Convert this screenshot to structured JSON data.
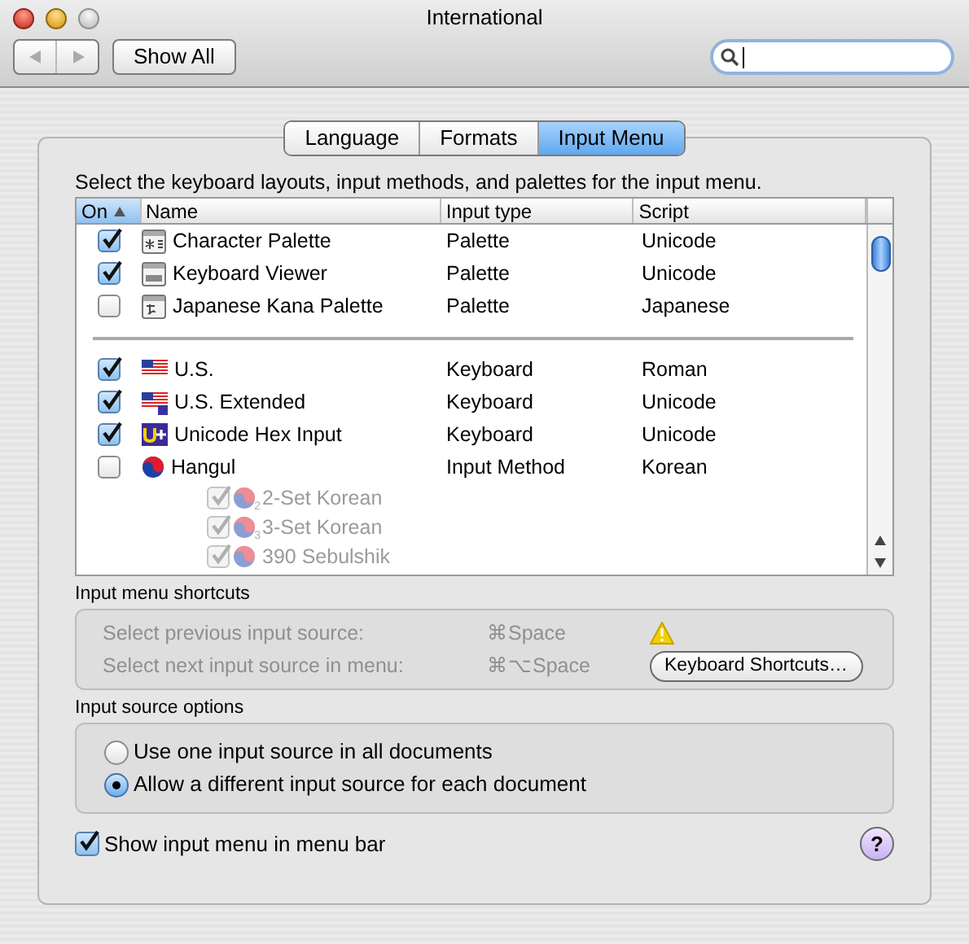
{
  "window": {
    "title": "International"
  },
  "toolbar": {
    "show_all": "Show All"
  },
  "tabs": [
    {
      "label": "Language",
      "selected": false
    },
    {
      "label": "Formats",
      "selected": false
    },
    {
      "label": "Input Menu",
      "selected": true
    }
  ],
  "description": "Select the keyboard layouts, input methods, and palettes for the input menu.",
  "table": {
    "columns": [
      {
        "label": "On",
        "sorted": true
      },
      {
        "label": "Name",
        "sorted": false
      },
      {
        "label": "Input type",
        "sorted": false
      },
      {
        "label": "Script",
        "sorted": false
      }
    ],
    "groups": [
      [
        {
          "checked": true,
          "kind": "character_palette",
          "name": "Character Palette",
          "input_type": "Palette",
          "script": "Unicode"
        },
        {
          "checked": true,
          "kind": "keyboard_viewer",
          "name": "Keyboard Viewer",
          "input_type": "Palette",
          "script": "Unicode"
        },
        {
          "checked": false,
          "kind": "kana_palette",
          "name": "Japanese Kana Palette",
          "input_type": "Palette",
          "script": "Japanese"
        }
      ],
      [
        {
          "checked": true,
          "kind": "flag_us",
          "name": "U.S.",
          "input_type": "Keyboard",
          "script": "Roman"
        },
        {
          "checked": true,
          "kind": "flag_us_extended",
          "name": "U.S. Extended",
          "input_type": "Keyboard",
          "script": "Unicode"
        },
        {
          "checked": true,
          "kind": "unicode",
          "name": "Unicode Hex Input",
          "input_type": "Keyboard",
          "script": "Unicode"
        },
        {
          "checked": false,
          "kind": "korean",
          "name": "Hangul",
          "input_type": "Input Method",
          "script": "Korean",
          "children": [
            {
              "checked": true,
              "disabled": true,
              "kind": "korean",
              "badge": "2",
              "name": "2-Set Korean"
            },
            {
              "checked": true,
              "disabled": true,
              "kind": "korean",
              "badge": "3",
              "name": "3-Set Korean"
            },
            {
              "checked": true,
              "disabled": true,
              "kind": "korean",
              "name": "390 Sebulshik"
            }
          ]
        }
      ]
    ]
  },
  "shortcuts": {
    "title": "Input menu shortcuts",
    "disabled": true,
    "rows": [
      {
        "label": "Select previous input source:",
        "keys": "⌘Space",
        "warning": true
      },
      {
        "label": "Select next input source in menu:",
        "keys": "⌘⌥Space",
        "warning": false
      }
    ],
    "button": "Keyboard Shortcuts…"
  },
  "options": {
    "title": "Input source options",
    "items": [
      {
        "label": "Use one input source in all documents",
        "selected": false
      },
      {
        "label": "Allow a different input source for each document",
        "selected": true
      }
    ]
  },
  "show_menu": {
    "label": "Show input menu in menu bar",
    "checked": true
  },
  "help": "?"
}
